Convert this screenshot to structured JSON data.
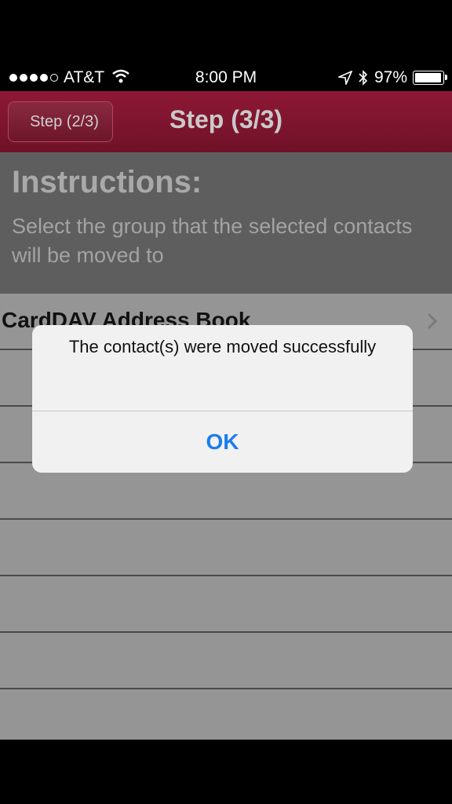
{
  "status_bar": {
    "carrier": "AT&T",
    "time": "8:00 PM",
    "battery": "97%",
    "battery_level": 0.97,
    "signal_bars": 4,
    "signal_total": 5
  },
  "nav": {
    "back_label": "Step (2/3)",
    "title": "Step (3/3)"
  },
  "instructions": {
    "heading": "Instructions:",
    "text": "Select the group that the selected contacts will be moved to"
  },
  "list": {
    "items": [
      {
        "label": "CardDAV Address Book"
      },
      {
        "label": ""
      },
      {
        "label": ""
      },
      {
        "label": ""
      },
      {
        "label": ""
      },
      {
        "label": ""
      },
      {
        "label": ""
      }
    ]
  },
  "alert": {
    "message": "The contact(s) were moved successfully",
    "button": "OK"
  },
  "colors": {
    "nav_bar": "#8e1835",
    "alert_button": "#1a7df0"
  }
}
